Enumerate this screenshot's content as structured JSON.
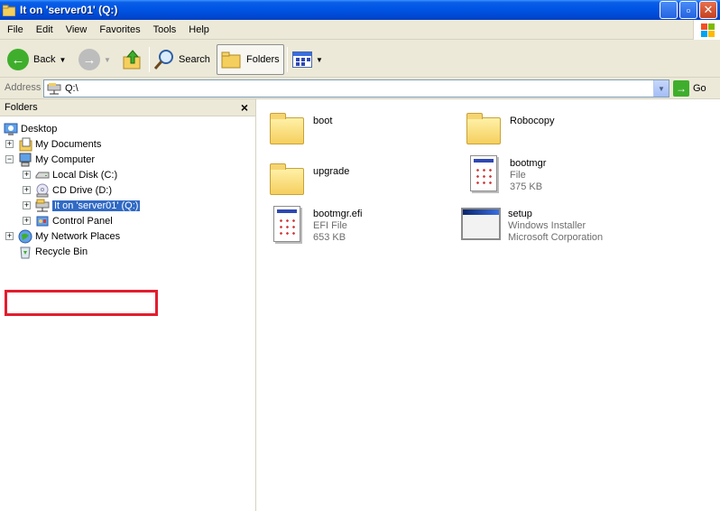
{
  "window": {
    "title": "It on 'server01' (Q:)"
  },
  "menu": [
    "File",
    "Edit",
    "View",
    "Favorites",
    "Tools",
    "Help"
  ],
  "toolbar": {
    "back_label": "Back",
    "search_label": "Search",
    "folders_label": "Folders"
  },
  "address": {
    "label": "Address",
    "value": "Q:\\",
    "go_label": "Go"
  },
  "folder_pane": {
    "title": "Folders",
    "tree": [
      {
        "label": "Desktop",
        "icon": "desktop-icon"
      },
      {
        "label": "My Documents",
        "icon": "my-documents-icon",
        "expander": "+"
      },
      {
        "label": "My Computer",
        "icon": "my-computer-icon",
        "expander": "−"
      },
      {
        "label": "Local Disk (C:)",
        "icon": "hard-drive-icon",
        "expander": "+"
      },
      {
        "label": "CD Drive (D:)",
        "icon": "cd-drive-icon",
        "expander": "+"
      },
      {
        "label": "It on 'server01' (Q:)",
        "icon": "network-drive-icon",
        "expander": "+",
        "selected": true
      },
      {
        "label": "Control Panel",
        "icon": "control-panel-icon",
        "expander": "+"
      },
      {
        "label": "My Network Places",
        "icon": "network-places-icon",
        "expander": "+"
      },
      {
        "label": "Recycle Bin",
        "icon": "recycle-bin-icon"
      }
    ]
  },
  "files": [
    {
      "name": "boot",
      "icon": "folder-icon"
    },
    {
      "name": "Robocopy",
      "icon": "folder-icon"
    },
    {
      "name": "upgrade",
      "icon": "folder-icon"
    },
    {
      "name": "bootmgr",
      "type": "File",
      "size": "375 KB",
      "icon": "system-file-icon"
    },
    {
      "name": "bootmgr.efi",
      "type": "EFI File",
      "size": "653 KB",
      "icon": "system-file-icon"
    },
    {
      "name": "setup",
      "type": "Windows Installer",
      "size": "Microsoft Corporation",
      "icon": "installer-icon"
    }
  ],
  "colors": {
    "titlebar": "#0055e5",
    "selection": "#316ac5",
    "highlight_box": "#e31d2e"
  }
}
